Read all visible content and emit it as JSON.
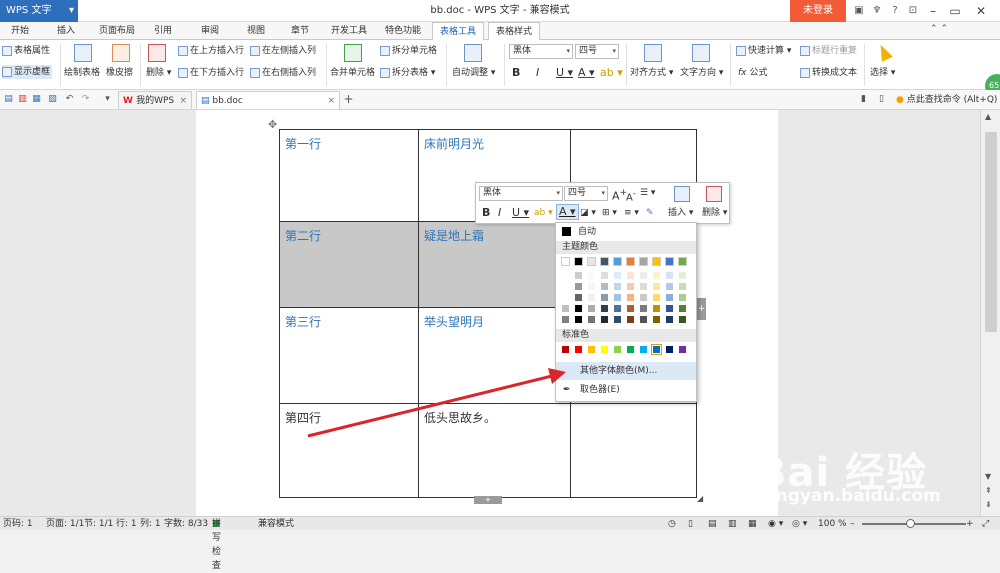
{
  "app": {
    "name": "WPS 文字",
    "doc_title": "bb.doc - WPS 文字 - 兼容模式",
    "login": "未登录"
  },
  "menu_tabs": [
    "开始",
    "插入",
    "页面布局",
    "引用",
    "审阅",
    "视图",
    "章节",
    "开发工具",
    "特色功能",
    "表格工具",
    "表格样式"
  ],
  "ribbon": {
    "table_props": "表格属性",
    "show_grid": "显示虚框",
    "draw_table": "绘制表格",
    "eraser": "橡皮擦",
    "delete": "删除",
    "insert_above": "在上方插入行",
    "insert_below": "在下方插入行",
    "insert_left": "在左侧插入列",
    "insert_right": "在右侧插入列",
    "merge": "合并单元格",
    "split_cell": "拆分单元格",
    "split_table": "拆分表格",
    "auto_fit": "自动调整",
    "font": "黑体",
    "size": "四号",
    "align": "对齐方式",
    "text_dir": "文字方向",
    "formula": "公式",
    "quick_calc": "快速计算",
    "repeat_header": "标题行重复",
    "convert_text": "转换成文本",
    "select": "选择",
    "badge": "65"
  },
  "doc_tabs": [
    "我的WPS",
    "bb.doc"
  ],
  "command_search": "点此查找命令 (Alt+Q)",
  "table": {
    "rows": [
      [
        "第一行",
        "床前明月光",
        ""
      ],
      [
        "第二行",
        "疑是地上霜",
        ""
      ],
      [
        "第三行",
        "举头望明月",
        ""
      ],
      [
        "第四行",
        "低头思故乡。",
        ""
      ]
    ]
  },
  "minibar": {
    "font": "黑体",
    "size": "四号",
    "insert": "插入",
    "delete": "删除"
  },
  "color_menu": {
    "auto": "自动",
    "theme_header": "主题颜色",
    "standard_header": "标准色",
    "more_colors": "其他字体颜色(M)...",
    "eyedropper": "取色器(E)",
    "theme_top": [
      "#ffffff",
      "#000000",
      "#e7e6e6",
      "#44546a",
      "#5b9bd5",
      "#ed7d31",
      "#a5a5a5",
      "#ffc000",
      "#4472c4",
      "#70ad47"
    ],
    "standard": [
      "#c00000",
      "#ff0000",
      "#ffc000",
      "#ffff00",
      "#92d050",
      "#00b050",
      "#00b0f0",
      "#0070c0",
      "#002060",
      "#7030a0"
    ]
  },
  "status": {
    "page": "页码: 1",
    "pages": "页面: 1/1",
    "section": "节: 1/1",
    "row": "行: 1",
    "col": "列: 1",
    "chars": "字数: 8/33",
    "spell": "拼写检查",
    "compat": "兼容模式",
    "zoom": "100 %"
  },
  "watermark": {
    "main": "Bai 经验",
    "url": "jingyan.baidu.com"
  }
}
